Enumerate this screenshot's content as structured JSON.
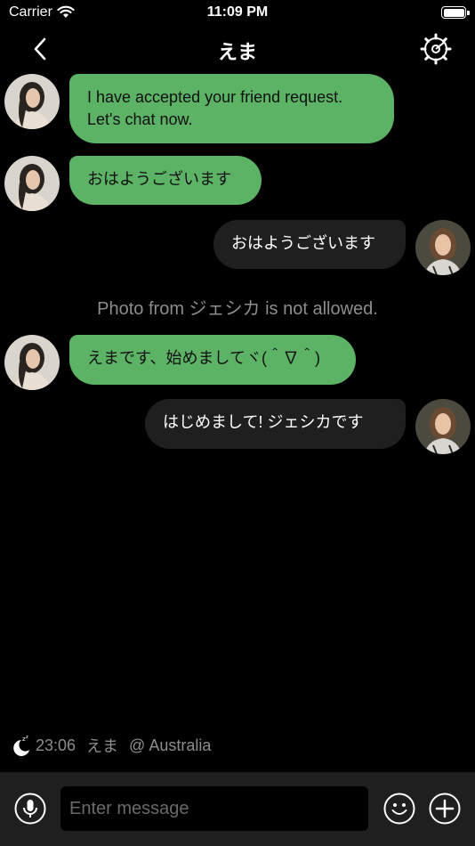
{
  "status_bar": {
    "carrier": "Carrier",
    "time": "11:09 PM",
    "battery_level": 1.0
  },
  "nav": {
    "title": "えま",
    "back_icon": "chevron-left-icon",
    "settings_icon": "gear-icon"
  },
  "messages": [
    {
      "sender": "えま",
      "direction": "incoming",
      "text": "I have accepted your friend request. Let's chat now."
    },
    {
      "sender": "えま",
      "direction": "incoming",
      "text": "おはようございます"
    },
    {
      "sender": "ジェシカ",
      "direction": "outgoing",
      "text": "おはようございます"
    },
    {
      "sender": "えま",
      "direction": "incoming",
      "text": "えまです、始めましてヾ(＾∇＾)"
    },
    {
      "sender": "ジェシカ",
      "direction": "outgoing",
      "text": "はじめまして! ジェシカです"
    }
  ],
  "system_note": "Photo from ジェシカ is not allowed.",
  "presence": {
    "icon": "moon-sleep-icon",
    "time": "23:06",
    "name": "えま",
    "location": "@ Australia"
  },
  "input_bar": {
    "placeholder": "Enter message",
    "mic_icon": "microphone-icon",
    "emoji_icon": "smiley-icon",
    "add_icon": "plus-circle-icon"
  },
  "colors": {
    "incoming_bubble": "#5cb265",
    "outgoing_bubble": "#1f1f1f",
    "background": "#000000",
    "muted_text": "#8d8d8d"
  }
}
